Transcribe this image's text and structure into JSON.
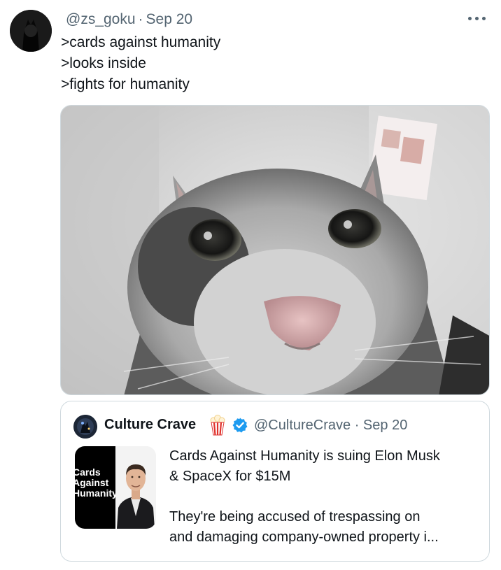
{
  "tweet": {
    "handle": "@zs_goku",
    "separator": "·",
    "date": "Sep 20",
    "lines": [
      ">cards against humanity",
      ">looks inside",
      ">fights for humanity"
    ]
  },
  "quote": {
    "name": "Culture Crave",
    "handle": "@CultureCrave",
    "separator": "·",
    "date": "Sep 20",
    "thumb_text": [
      "Cards",
      "Against",
      "Humanity"
    ],
    "text_lines": [
      "Cards Against Humanity is suing Elon Musk",
      "& SpaceX for $15M"
    ],
    "text_lines_2": [
      "They're being accused of trespassing on",
      "and damaging company-owned property i..."
    ]
  },
  "colors": {
    "text": "#0f1419",
    "secondary": "#536471",
    "border": "#cfd9de",
    "verified": "#1d9bf0"
  },
  "icons": [
    "more-icon",
    "verified-badge-icon",
    "popcorn-emoji-icon"
  ]
}
